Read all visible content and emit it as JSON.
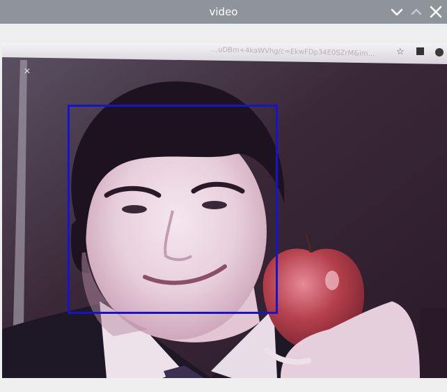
{
  "window": {
    "title": "video",
    "controls": {
      "minimize": "chevron-down-icon",
      "maximize": "chevron-up-icon",
      "close": "close-icon"
    }
  },
  "video": {
    "browser_fragment": {
      "url_text": "…uDBm+4kaWVhg/c=EkwFDp34E0SZrM&im…"
    },
    "detection": {
      "label": "",
      "color": "#1414d0"
    }
  },
  "colors": {
    "titlebar": "#8e949a",
    "window_bg": "#efefef",
    "detection_box": "#1414d0"
  }
}
